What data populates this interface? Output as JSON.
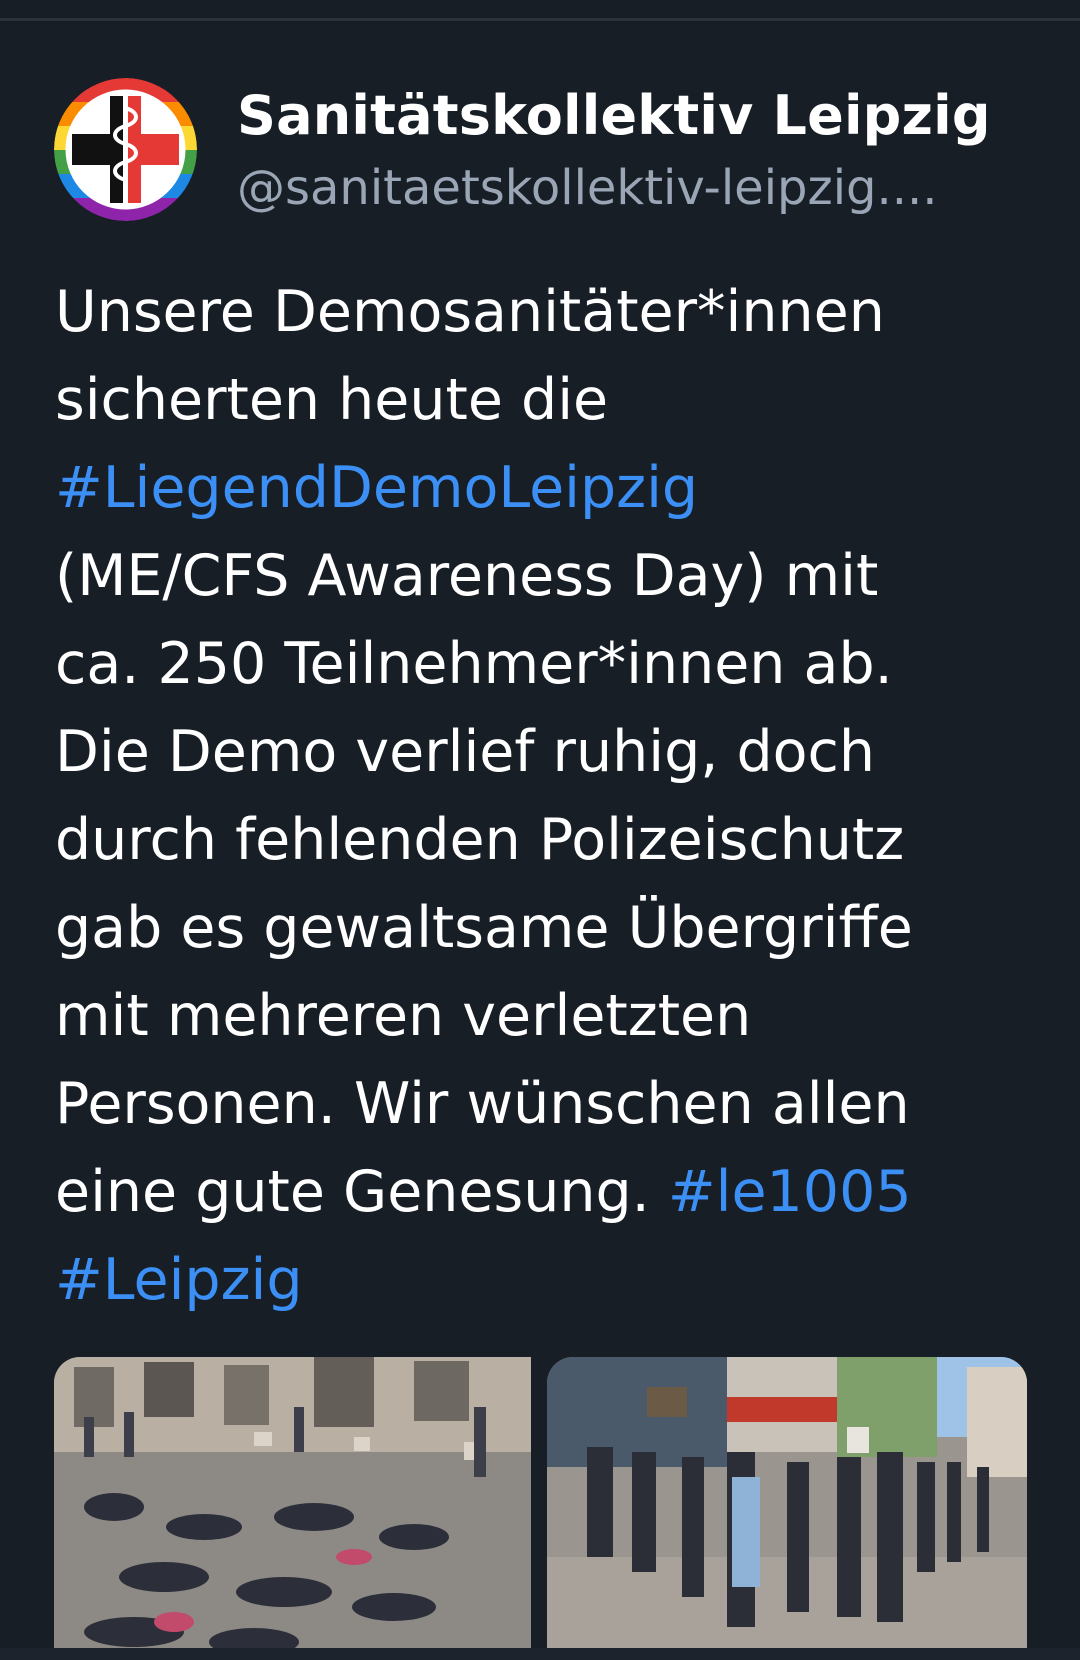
{
  "author": {
    "display_name": "Sanitätskollektiv Leipzig",
    "handle": "@sanitaetskollektiv-leipzig....",
    "avatar_icon": "medic-cross-rainbow-logo"
  },
  "post": {
    "lines": [
      [
        {
          "t": "Unsere Demosanitäter*innen"
        }
      ],
      [
        {
          "t": "sicherten heute die"
        }
      ],
      [
        {
          "t": "#LiegendDemoLeipzig",
          "tag": true
        }
      ],
      [
        {
          "t": "(ME/CFS Awareness Day) mit"
        }
      ],
      [
        {
          "t": "ca. 250 Teilnehmer*innen ab."
        }
      ],
      [
        {
          "t": "Die Demo verlief ruhig, doch"
        }
      ],
      [
        {
          "t": "durch fehlenden Polizeischutz"
        }
      ],
      [
        {
          "t": "gab es gewaltsame Übergriffe"
        }
      ],
      [
        {
          "t": "mit mehreren verletzten"
        }
      ],
      [
        {
          "t": "Personen. Wir wünschen allen"
        }
      ],
      [
        {
          "t": "eine gute Genesung. "
        },
        {
          "t": "#le1005",
          "tag": true
        }
      ],
      [
        {
          "t": "#Leipzig",
          "tag": true
        }
      ]
    ]
  },
  "media": [
    {
      "name": "photo-lie-in-demonstration"
    },
    {
      "name": "photo-street-march"
    }
  ],
  "colors": {
    "background": "#171e26",
    "hashtag": "#3b8ff5",
    "handle": "#9aa6b5",
    "text": "#ffffff"
  }
}
